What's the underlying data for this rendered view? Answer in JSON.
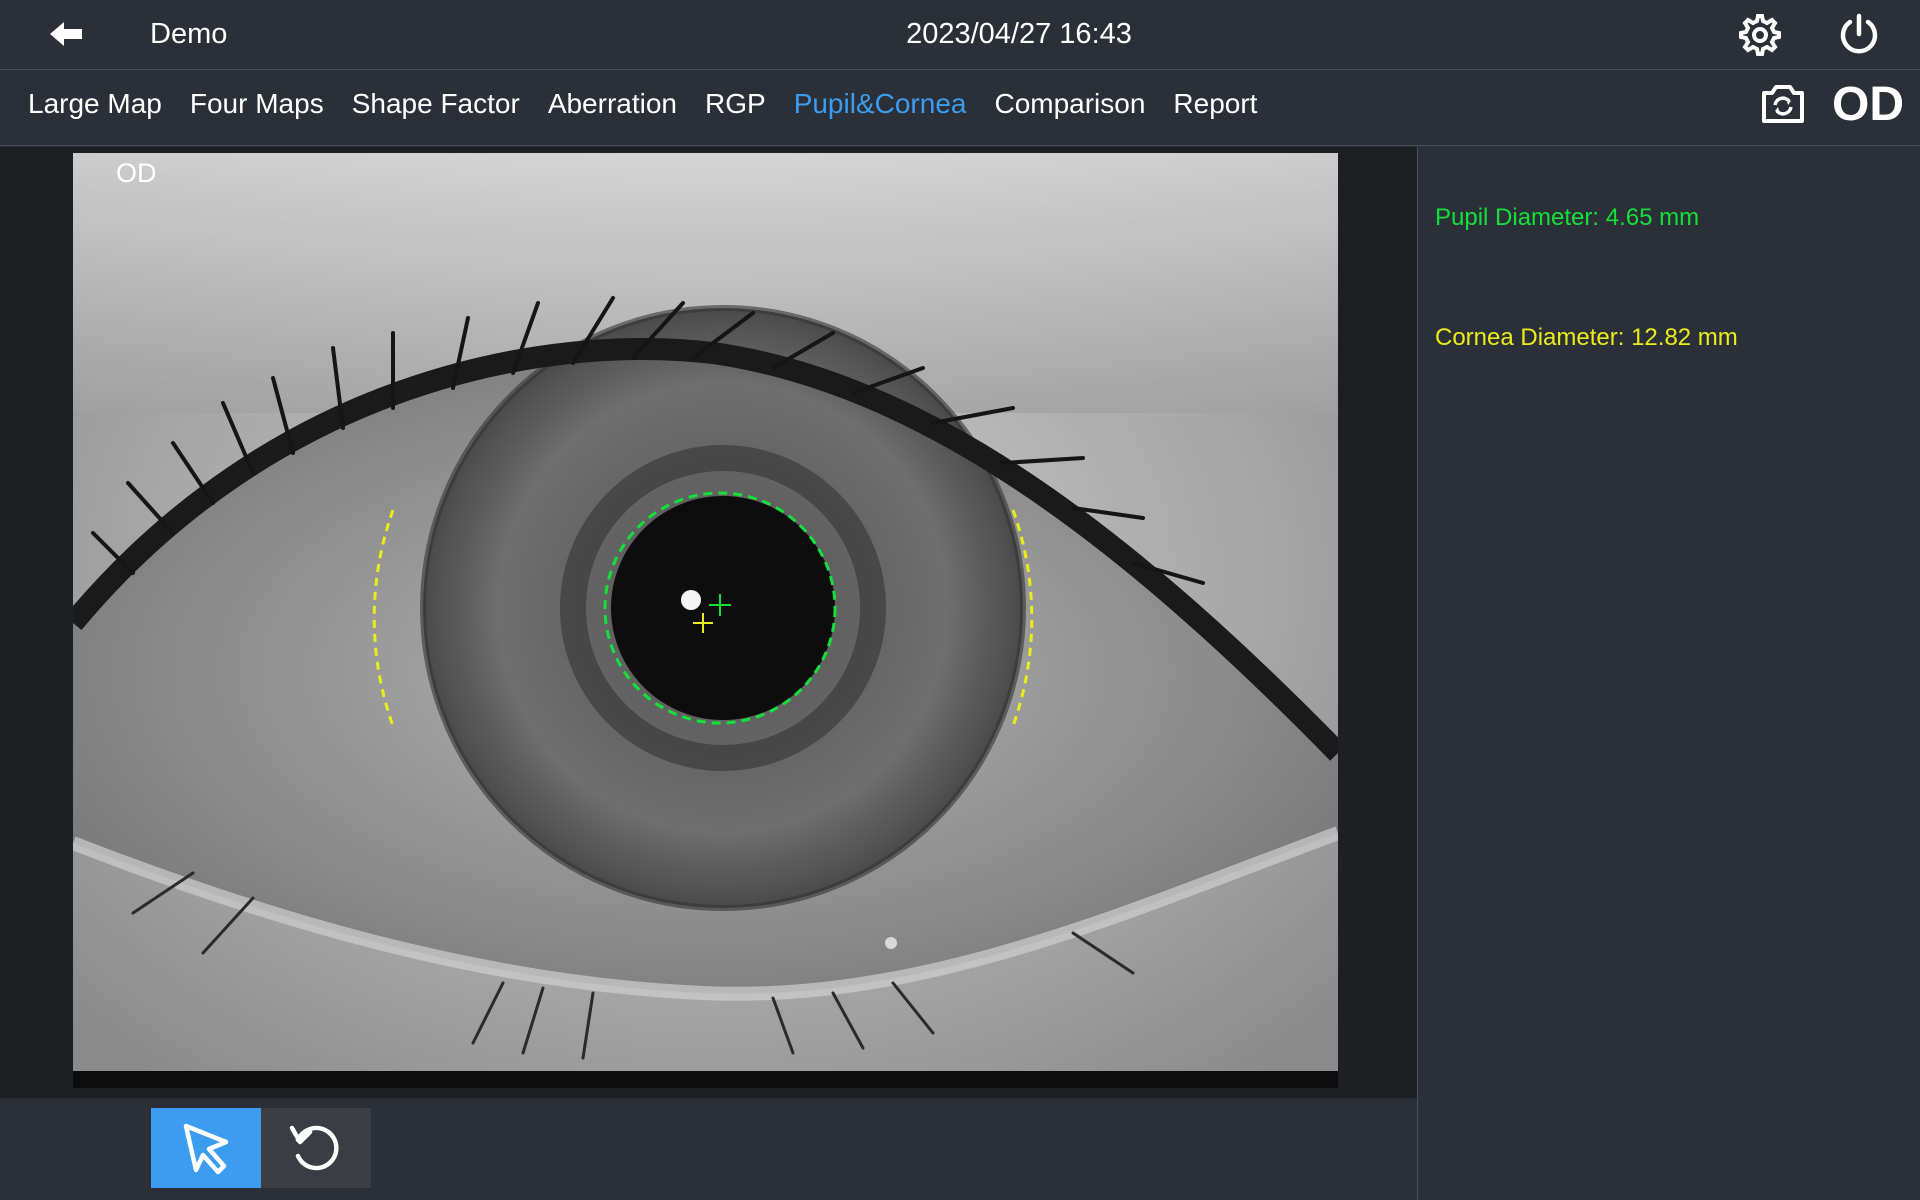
{
  "header": {
    "title": "Demo",
    "datetime": "2023/04/27 16:43",
    "back_icon": "arrow-left-icon",
    "settings_icon": "gear-icon",
    "power_icon": "power-icon"
  },
  "tabs": [
    {
      "label": "Large Map",
      "active": false
    },
    {
      "label": "Four Maps",
      "active": false
    },
    {
      "label": "Shape Factor",
      "active": false
    },
    {
      "label": "Aberration",
      "active": false
    },
    {
      "label": "RGP",
      "active": false
    },
    {
      "label": "Pupil&Cornea",
      "active": true
    },
    {
      "label": "Comparison",
      "active": false
    },
    {
      "label": "Report",
      "active": false
    }
  ],
  "toolbar_right": {
    "camera_icon": "camera-switch-icon",
    "eye_side": "OD"
  },
  "image_panel": {
    "label": "OD",
    "image_description_icon": "eye-photo"
  },
  "measurements": {
    "pupil": "Pupil Diameter: 4.65 mm",
    "cornea": "Cornea Diameter: 12.82 mm"
  },
  "bottom_tools": {
    "select_icon": "cursor-arrow-icon",
    "reset_icon": "rotate-reset-icon",
    "selected": "select"
  },
  "colors": {
    "accent": "#3b9cf0",
    "pupil": "#15e03a",
    "cornea": "#ecec1a",
    "background": "#2b2f38"
  }
}
